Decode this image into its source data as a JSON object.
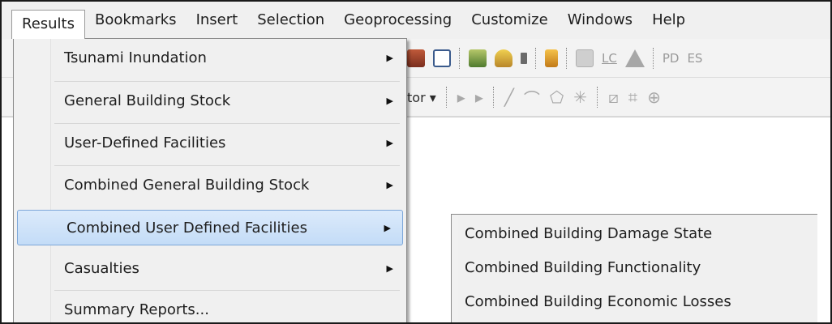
{
  "menubar": {
    "items": [
      {
        "label": "Results"
      },
      {
        "label": "Bookmarks"
      },
      {
        "label": "Insert"
      },
      {
        "label": "Selection"
      },
      {
        "label": "Geoprocessing"
      },
      {
        "label": "Customize"
      },
      {
        "label": "Windows"
      },
      {
        "label": "Help"
      }
    ]
  },
  "toolbar": {
    "text_lc": "LC",
    "text_pd": "PD",
    "text_es": "ES",
    "text_editor": "tor"
  },
  "results_menu": {
    "items": [
      {
        "label": "Tsunami Inundation",
        "has_submenu": true
      },
      {
        "label": "General Building Stock",
        "has_submenu": true
      },
      {
        "label": "User-Defined Facilities",
        "has_submenu": true
      },
      {
        "label": "Combined General Building Stock",
        "has_submenu": true
      },
      {
        "label": "Combined User Defined Facilities",
        "has_submenu": true,
        "highlighted": true
      },
      {
        "label": "Casualties",
        "has_submenu": true
      },
      {
        "label": "Summary Reports...",
        "has_submenu": false
      }
    ]
  },
  "submenu": {
    "items": [
      {
        "label": "Combined Building Damage State"
      },
      {
        "label": "Combined Building Functionality"
      },
      {
        "label": "Combined Building Economic Losses"
      }
    ]
  },
  "colors": {
    "highlight_bg": "#c3dcf7",
    "highlight_border": "#7da7d9",
    "menu_bg": "#f0f0f0"
  }
}
